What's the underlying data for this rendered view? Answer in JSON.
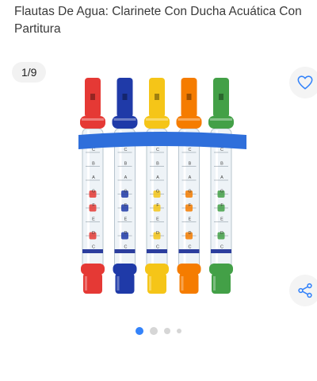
{
  "product": {
    "title": "Flautas De Agua: Clarinete Con Ducha Acuática Con Partitura"
  },
  "gallery": {
    "counter": "1/9",
    "total_images": 9,
    "current_index": 1,
    "indicator_dots": 4,
    "active_dot": 1,
    "accent_color": "#3483fa"
  },
  "actions": {
    "favorite_icon": "heart-outline-icon",
    "share_icon": "share-icon"
  },
  "flutes": [
    {
      "color": "#e53935",
      "notes": [
        "C",
        "B",
        "A",
        "G",
        "F",
        "E",
        "D",
        "C"
      ]
    },
    {
      "color": "#1f3aa8",
      "notes": [
        "C",
        "B",
        "A",
        "G",
        "F",
        "E",
        "D",
        "C"
      ]
    },
    {
      "color": "#f5c518",
      "notes": [
        "C",
        "B",
        "A",
        "G",
        "F",
        "E",
        "D",
        "C"
      ]
    },
    {
      "color": "#f57c00",
      "notes": [
        "C",
        "B",
        "A",
        "G",
        "F",
        "E",
        "D",
        "C"
      ]
    },
    {
      "color": "#43a047",
      "notes": [
        "C",
        "B",
        "A",
        "G",
        "F",
        "E",
        "D",
        "C"
      ]
    }
  ]
}
